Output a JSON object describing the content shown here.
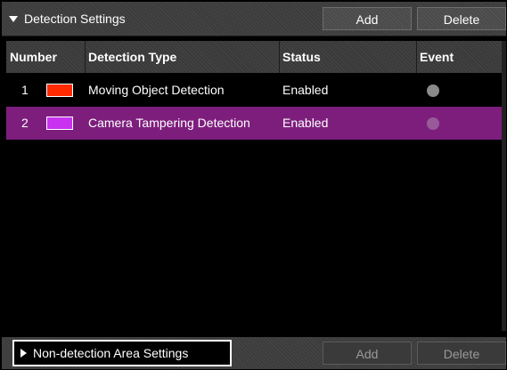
{
  "detection_settings": {
    "title": "Detection Settings",
    "add_label": "Add",
    "delete_label": "Delete"
  },
  "table": {
    "columns": [
      "Number",
      "Detection Type",
      "Status",
      "Event"
    ],
    "rows": [
      {
        "number": "1",
        "color": "#ff2a00",
        "type": "Moving Object Detection",
        "status": "Enabled",
        "selected": false
      },
      {
        "number": "2",
        "color": "#c832f0",
        "type": "Camera Tampering Detection",
        "status": "Enabled",
        "selected": true
      }
    ]
  },
  "non_detection": {
    "title": "Non-detection Area Settings",
    "add_label": "Add",
    "delete_label": "Delete"
  },
  "icons": {
    "expand": "triangle-down-icon",
    "collapse": "triangle-right-icon",
    "event": "event-indicator-dot"
  },
  "colors": {
    "selected_row": "#7d1e7d",
    "panel": "#3c3c3c",
    "background": "#000000"
  }
}
